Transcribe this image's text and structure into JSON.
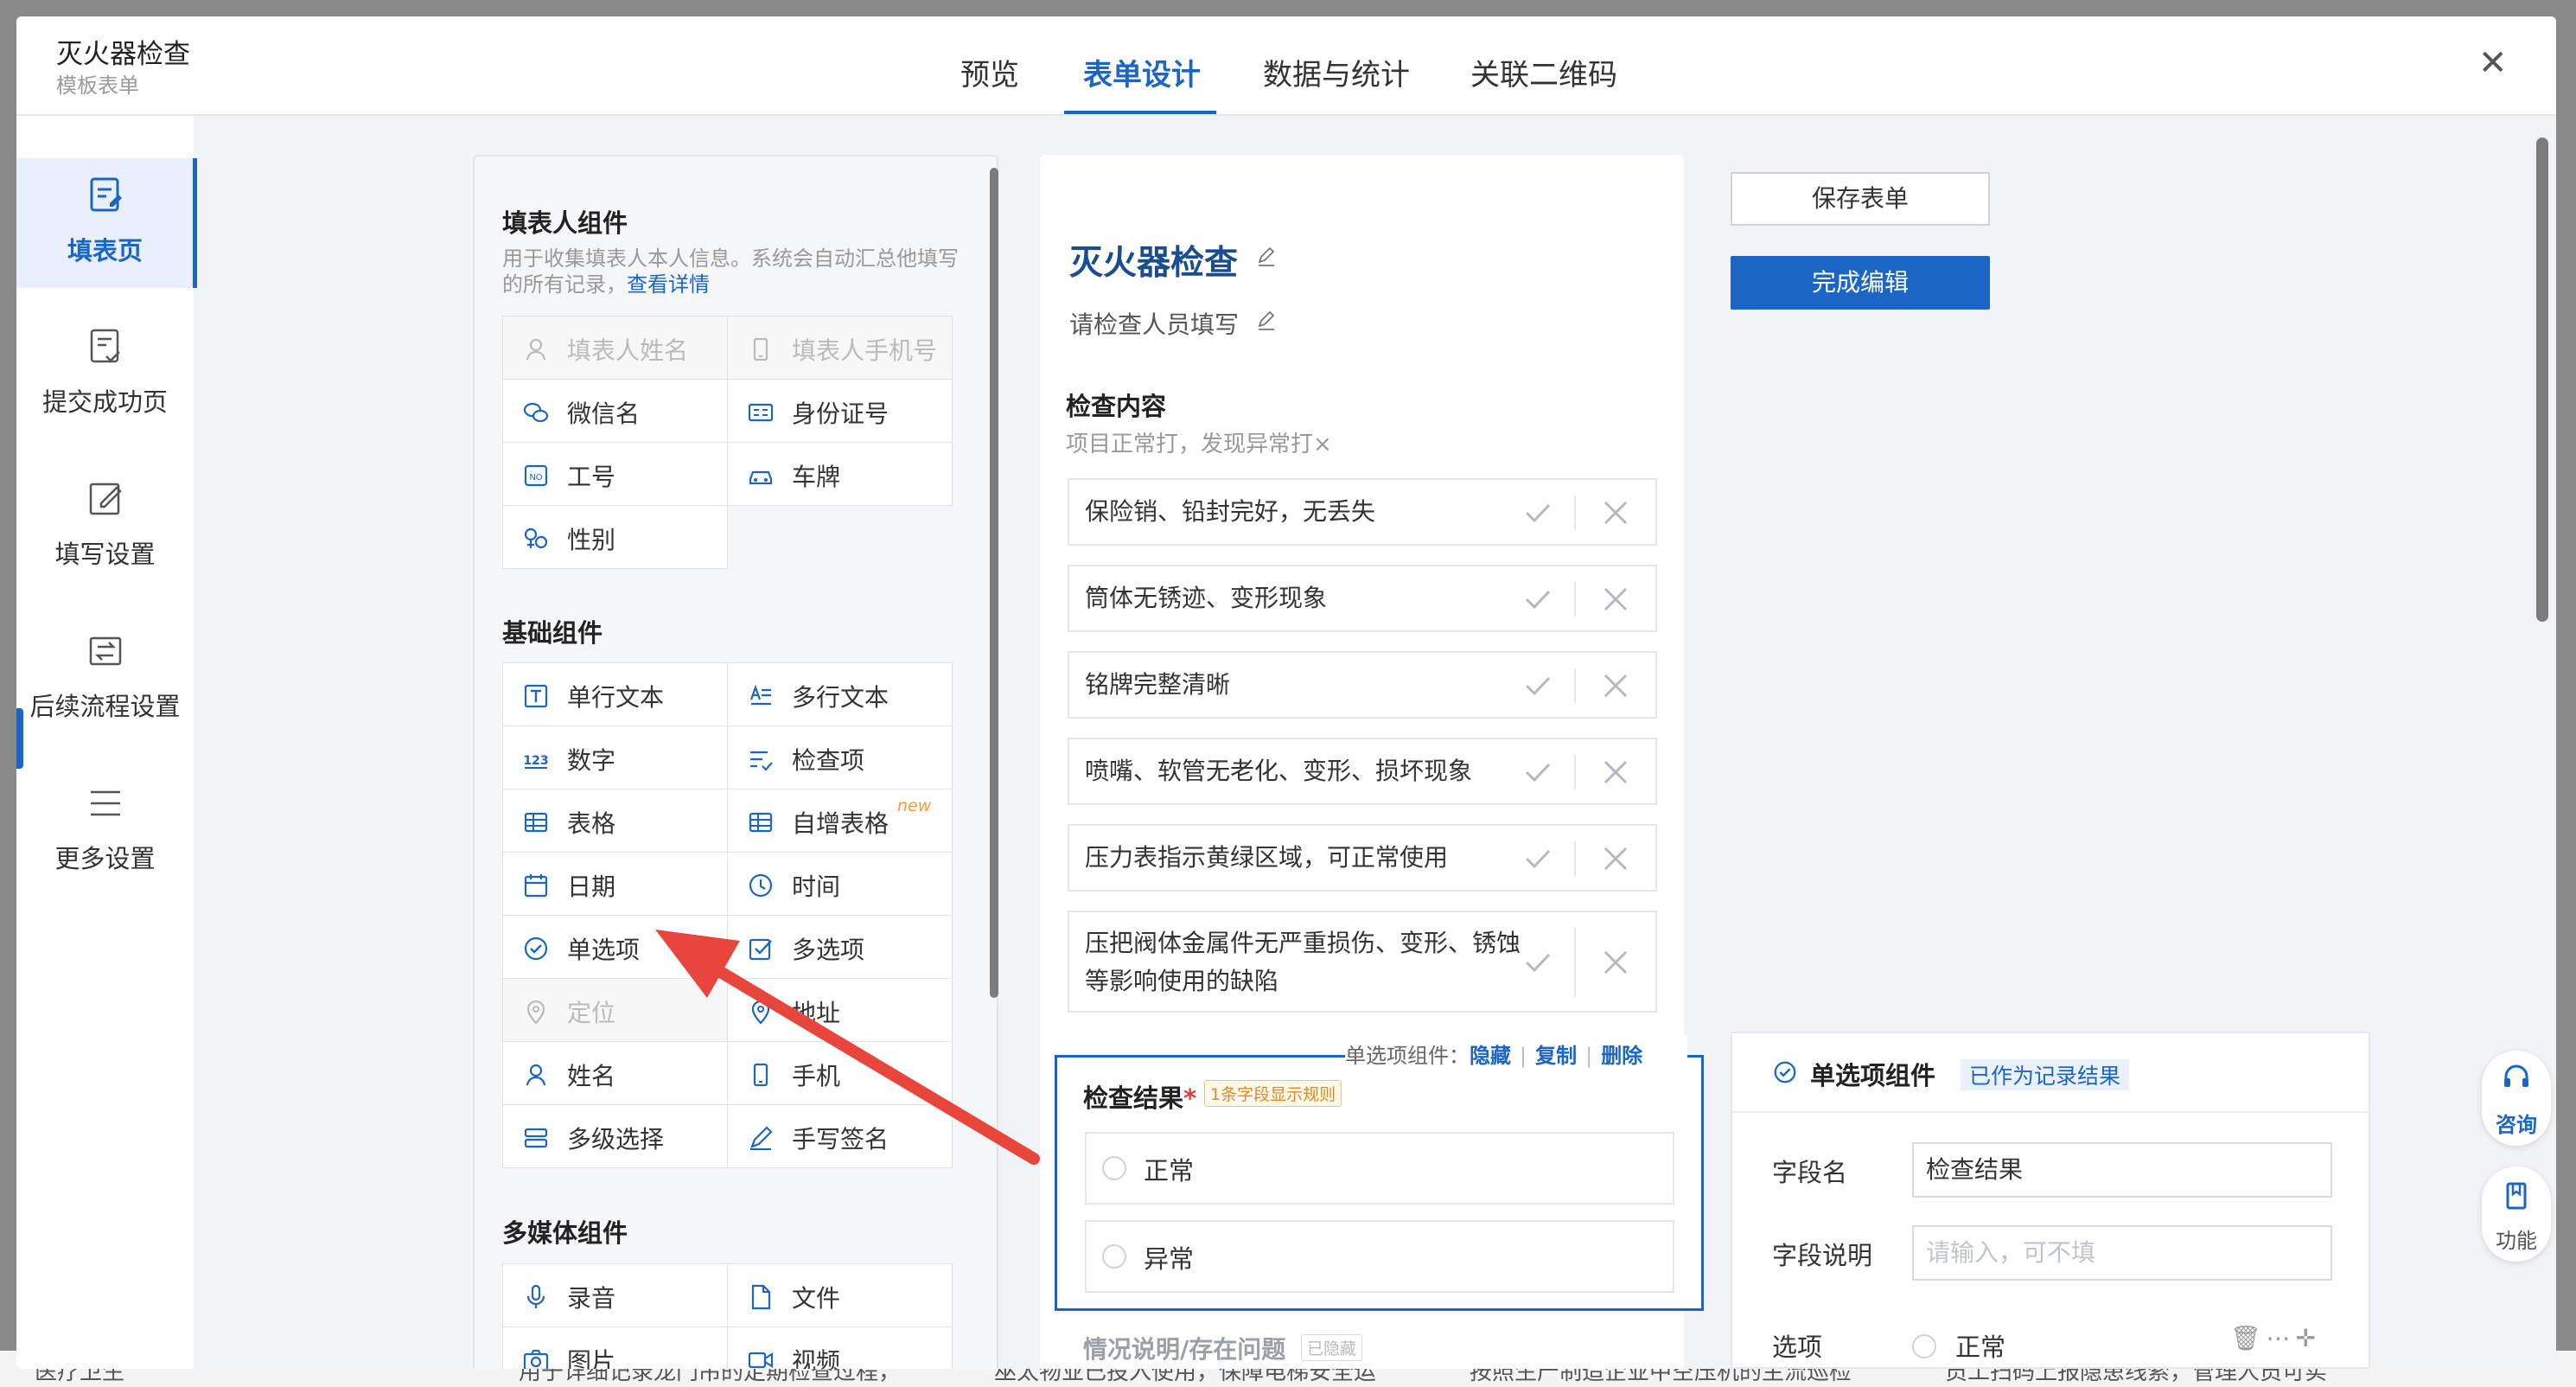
{
  "header": {
    "title": "灭火器检查",
    "subtitle": "模板表单",
    "tabs": [
      "预览",
      "表单设计",
      "数据与统计",
      "关联二维码"
    ],
    "active_tab": "表单设计"
  },
  "leftnav": {
    "items": [
      {
        "label": "填表页",
        "icon": "form-page-icon"
      },
      {
        "label": "提交成功页",
        "icon": "success-page-icon"
      },
      {
        "label": "填写设置",
        "icon": "edit-settings-icon"
      },
      {
        "label": "后续流程设置",
        "icon": "flow-icon"
      },
      {
        "label": "更多设置",
        "icon": "menu-icon"
      }
    ]
  },
  "components": {
    "filler": {
      "title": "填表人组件",
      "desc_prefix": "用于收集填表人本人信息。系统会自动汇总他填写的所有记录，",
      "desc_link": "查看详情",
      "items": [
        {
          "label": "填表人姓名",
          "icon": "person-icon",
          "disabled": true
        },
        {
          "label": "填表人手机号",
          "icon": "phone-icon",
          "disabled": true
        },
        {
          "label": "微信名",
          "icon": "wechat-icon"
        },
        {
          "label": "身份证号",
          "icon": "id-card-icon"
        },
        {
          "label": "工号",
          "icon": "employee-no-icon"
        },
        {
          "label": "车牌",
          "icon": "car-icon"
        },
        {
          "label": "性别",
          "icon": "gender-icon"
        }
      ]
    },
    "basic": {
      "title": "基础组件",
      "items": [
        {
          "label": "单行文本",
          "icon": "text-icon"
        },
        {
          "label": "多行文本",
          "icon": "multiline-text-icon"
        },
        {
          "label": "数字",
          "icon": "number-icon"
        },
        {
          "label": "检查项",
          "icon": "checklist-icon"
        },
        {
          "label": "表格",
          "icon": "table-icon"
        },
        {
          "label": "自增表格",
          "icon": "table-icon",
          "badge": "new"
        },
        {
          "label": "日期",
          "icon": "calendar-icon"
        },
        {
          "label": "时间",
          "icon": "clock-icon"
        },
        {
          "label": "单选项",
          "icon": "radio-check-icon"
        },
        {
          "label": "多选项",
          "icon": "checkbox-icon"
        },
        {
          "label": "定位",
          "icon": "location-icon",
          "disabled": true
        },
        {
          "label": "地址",
          "icon": "address-icon"
        },
        {
          "label": "姓名",
          "icon": "person-icon"
        },
        {
          "label": "手机",
          "icon": "phone-icon"
        },
        {
          "label": "多级选择",
          "icon": "cascade-icon"
        },
        {
          "label": "手写签名",
          "icon": "signature-icon"
        }
      ]
    },
    "media": {
      "title": "多媒体组件",
      "items": [
        {
          "label": "录音",
          "icon": "microphone-icon"
        },
        {
          "label": "文件",
          "icon": "file-icon"
        },
        {
          "label": "图片",
          "icon": "camera-icon"
        },
        {
          "label": "视频",
          "icon": "video-icon"
        }
      ]
    }
  },
  "form": {
    "title": "灭火器检查",
    "subtitle": "请检查人员填写",
    "section_title": "检查内容",
    "section_desc": "项目正常打，发现异常打×",
    "check_items": [
      "保险销、铅封完好，无丢失",
      "筒体无锈迹、变形现象",
      "铭牌完整清晰",
      "喷嘴、软管无老化、变形、损坏现象",
      "压力表指示黄绿区域，可正常使用",
      "压把阀体金属件无严重损伤、变形、锈蚀等影响使用的缺陷"
    ],
    "selected_field": {
      "label": "检查结果",
      "required_mark": "*",
      "rule_badge": "1条字段显示规则",
      "options": [
        "正常",
        "异常"
      ]
    },
    "toolbar": {
      "prefix": "单选项组件：",
      "hide": "隐藏",
      "copy": "复制",
      "delete": "删除"
    },
    "next_field": {
      "label": "情况说明/存在问题",
      "badge": "已隐藏"
    }
  },
  "actions": {
    "save": "保存表单",
    "done": "完成编辑"
  },
  "properties": {
    "title": "单选项组件",
    "tag": "已作为记录结果",
    "field_name_label": "字段名",
    "field_name_value": "检查结果",
    "field_desc_label": "字段说明",
    "field_desc_placeholder": "请输入，可不填",
    "options_label": "选项",
    "first_option": "正常"
  },
  "floating": {
    "consult": "咨询",
    "function": "功能"
  },
  "background": {
    "snippets": [
      "医疗卫生",
      "用于详细记录龙门吊的定期检查过程，",
      "巫太物业已投入使用，保障电梯安全运",
      "按照生产制造企业中空压机的主流巡检",
      "员工扫码上报隐患线索，管理人员可实"
    ]
  },
  "colors": {
    "accent": "#1b66c4",
    "annotation_arrow": "#e8453c"
  }
}
